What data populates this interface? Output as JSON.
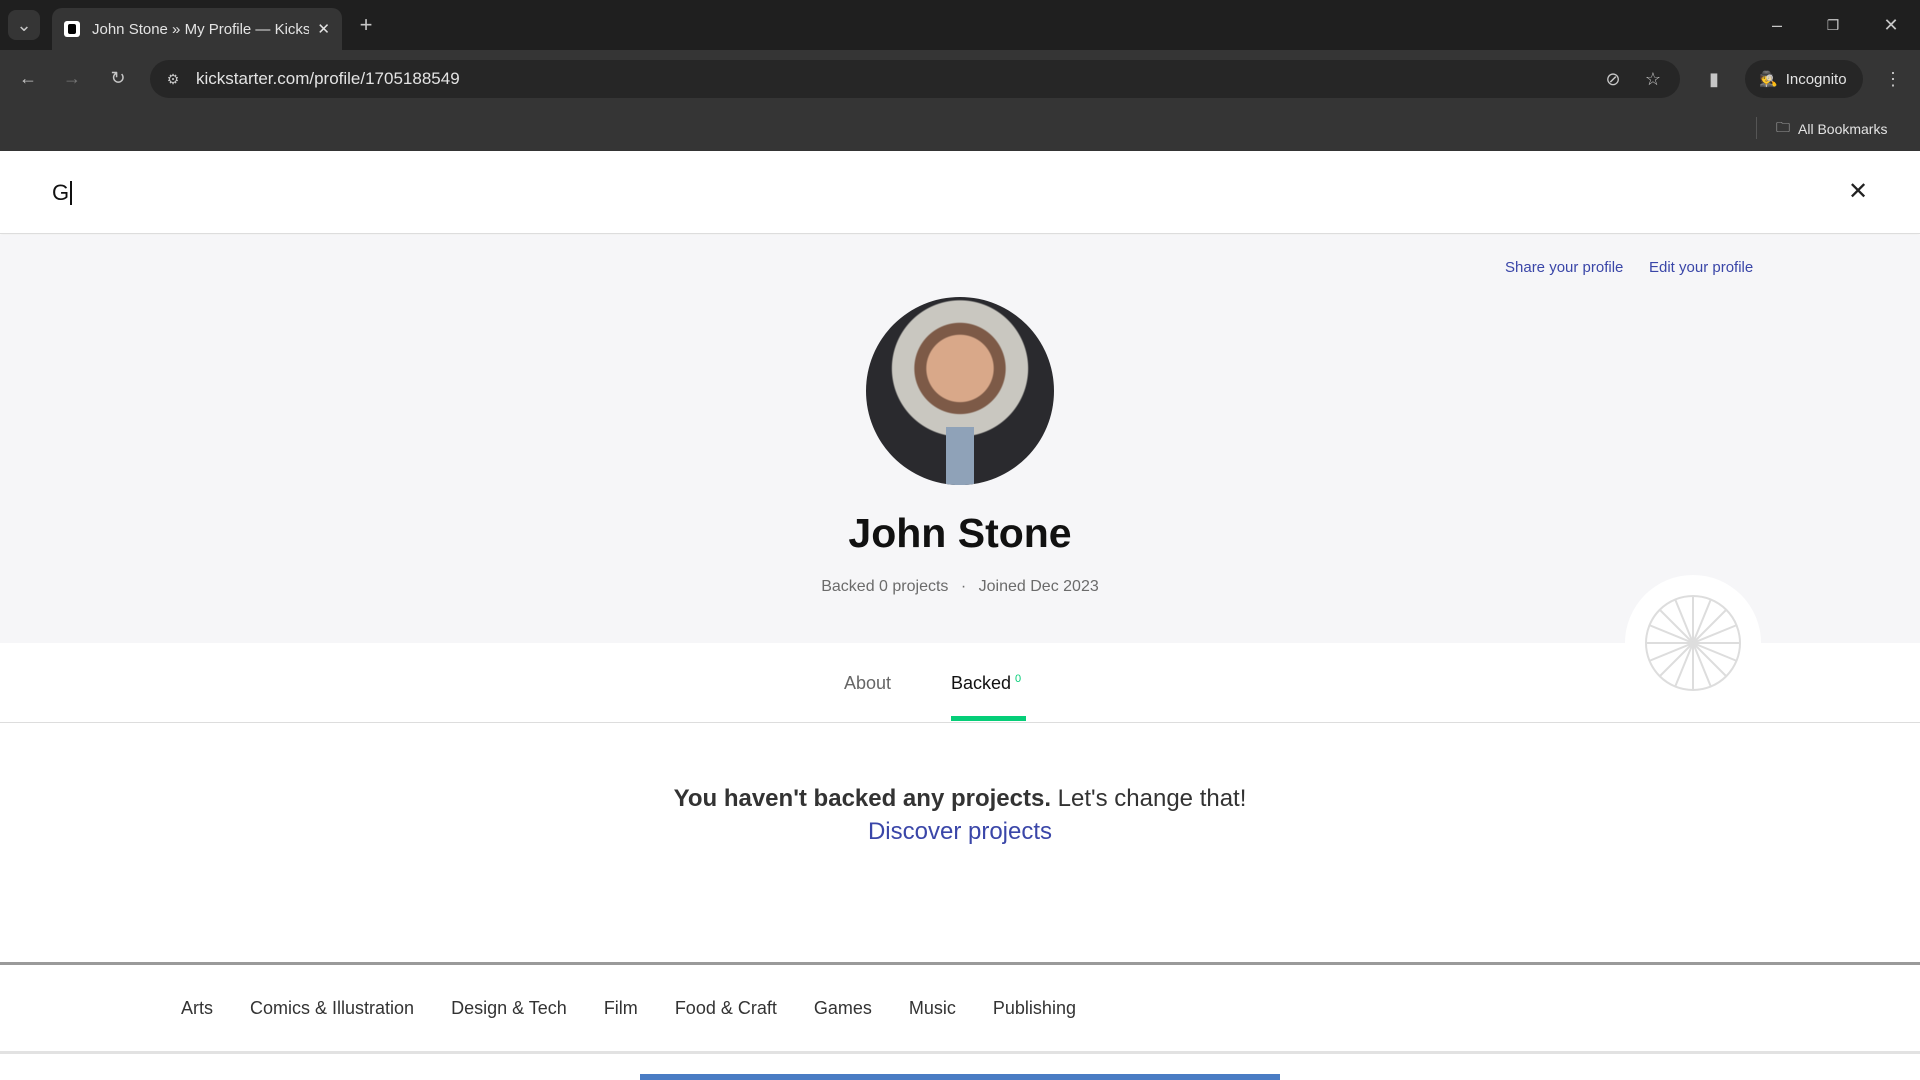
{
  "browser": {
    "tab_title": "John Stone » My Profile — Kickstarter",
    "url": "kickstarter.com/profile/1705188549",
    "incognito_label": "Incognito",
    "bookmarks_label": "All Bookmarks"
  },
  "search": {
    "value": "G"
  },
  "profile": {
    "share_label": "Share your profile",
    "edit_label": "Edit your profile",
    "name": "John Stone",
    "backed_text": "Backed 0 projects",
    "separator": "·",
    "joined_text": "Joined Dec 2023"
  },
  "tabs": [
    {
      "label": "About"
    },
    {
      "label": "Backed",
      "count": "0",
      "active": true
    }
  ],
  "empty": {
    "bold": "You haven't backed any projects.",
    "rest": " Let's change that!",
    "link": "Discover projects"
  },
  "footer": {
    "categories": [
      "Arts",
      "Comics & Illustration",
      "Design & Tech",
      "Film",
      "Food & Craft",
      "Games",
      "Music",
      "Publishing"
    ]
  },
  "colors": {
    "accent": "#05ce78",
    "link": "#3a46a8"
  }
}
